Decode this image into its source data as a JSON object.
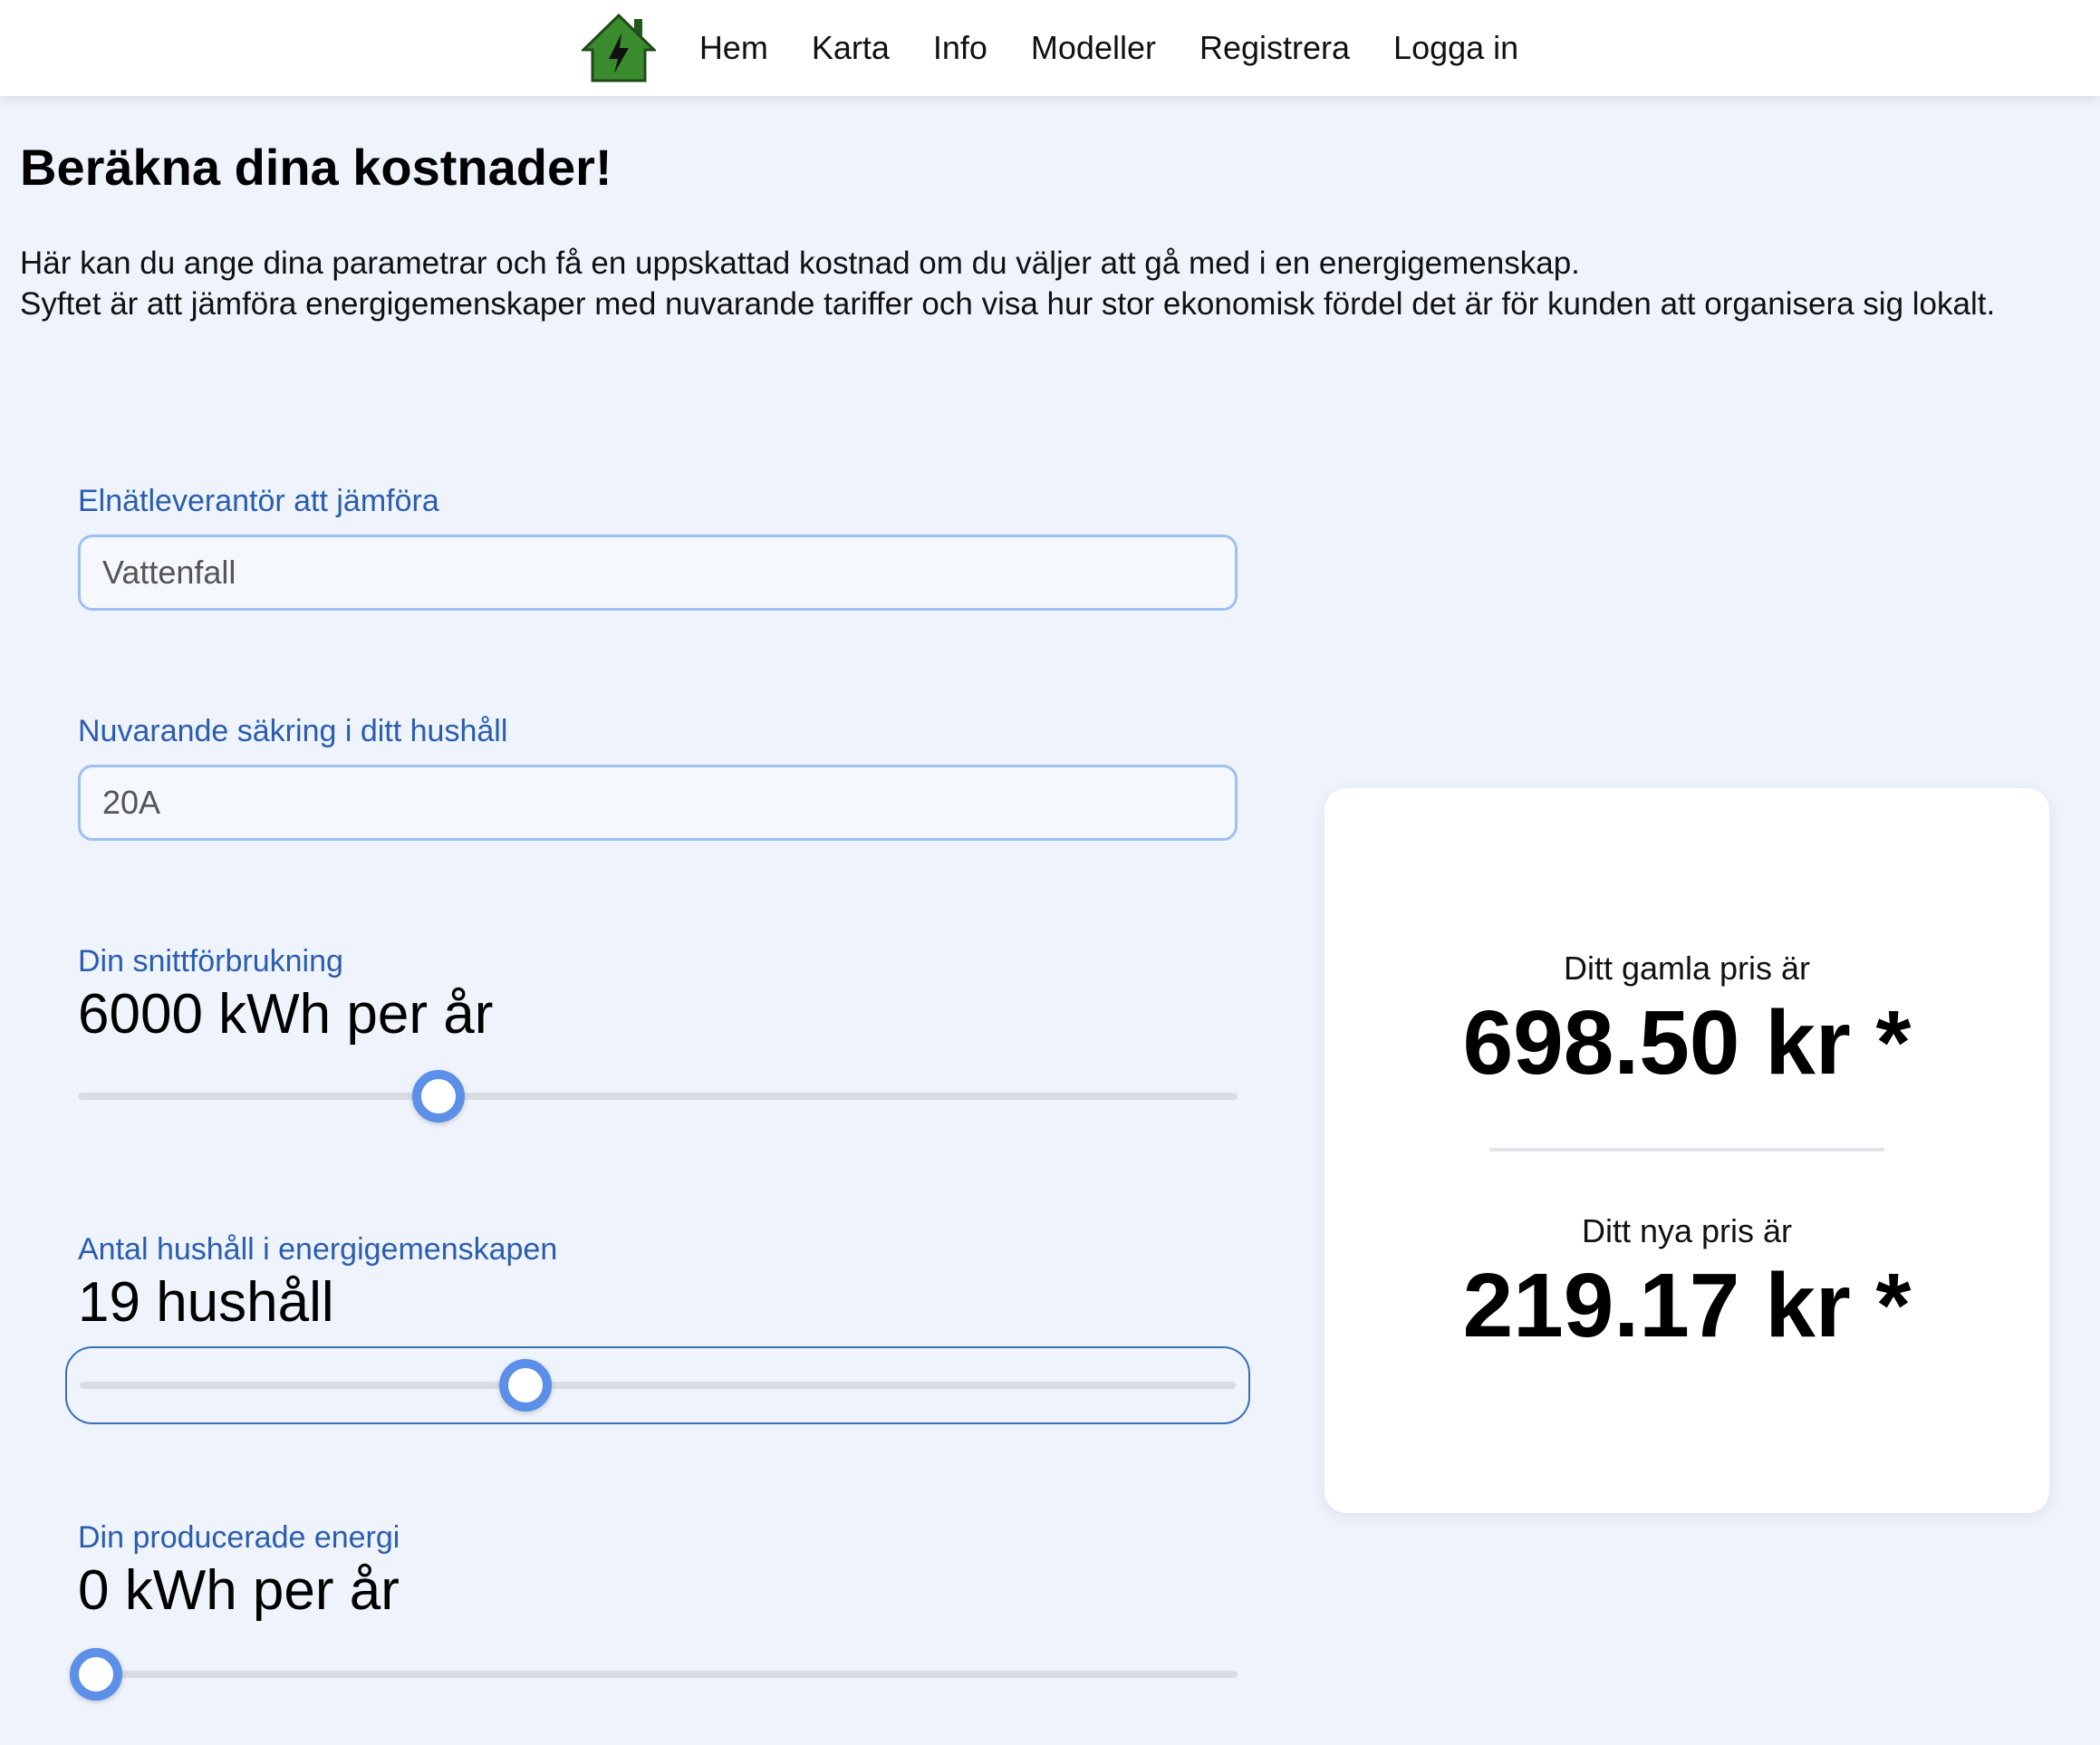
{
  "nav": {
    "logo_icon": "house-lightning-icon",
    "links": [
      "Hem",
      "Karta",
      "Info",
      "Modeller",
      "Registrera",
      "Logga in"
    ]
  },
  "page": {
    "title": "Beräkna dina kostnader!",
    "intro_line1": "Här kan du ange dina parametrar och få en uppskattad kostnad om du väljer att gå med i en energigemenskap.",
    "intro_line2": "Syftet är att jämföra energigemenskaper med nuvarande tariffer och visa hur stor ekonomisk fördel det är för kunden att organisera sig lokalt."
  },
  "form": {
    "provider": {
      "label": "Elnätleverantör att jämföra",
      "value": "Vattenfall"
    },
    "fuse": {
      "label": "Nuvarande säkring i ditt hushåll",
      "value": "20A"
    },
    "consumption": {
      "label": "Din snittförbrukning",
      "display": "6000 kWh per år",
      "slider_fraction": 0.305
    },
    "households": {
      "label": "Antal hushåll i energigemenskapen",
      "display": "19 hushåll",
      "slider_fraction": 0.382
    },
    "production": {
      "label": "Din producerade energi",
      "display": "0 kWh per år",
      "slider_fraction": 0.0
    }
  },
  "result": {
    "old_label": "Ditt gamla pris är",
    "old_value": "698.50 kr *",
    "new_label": "Ditt nya pris är",
    "new_value": "219.17 kr *"
  },
  "colors": {
    "accent": "#5b8fe8",
    "label_blue": "#2a5db0",
    "logo_green": "#3a8a2e"
  }
}
